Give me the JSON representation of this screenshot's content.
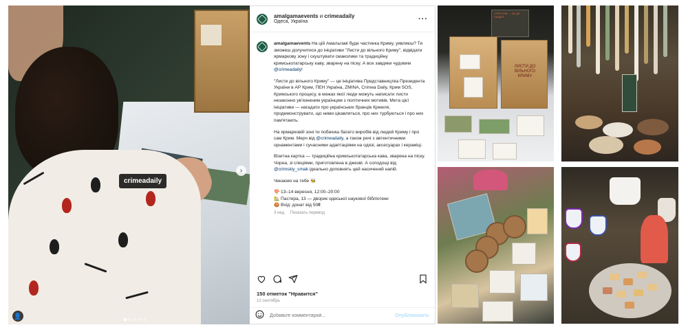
{
  "post": {
    "author": "amalgamaevents",
    "and": " и ",
    "coauthor": "crimeadaily",
    "location": "Одеса, Україна",
    "photo_tag": "crimeadaily",
    "caption": {
      "p1_user": "amalgamaevents",
      "p1_text": " На цій Амальгамі буде частинка Криму, уявляєш? Ти зможеш долучитися до ініціативи \"Листи до вільного Криму\", відвідати ярмаркову зону і скуштувати смаколики та традиційну кримськотатарську каву, зварену на піску. А все завдяки чудовим ",
      "p1_mention": "@crimeadaily",
      "p1_end": "!",
      "p2": "\"Листи до вільного Криму\" — це ініціатива Представництва Президента України в АР Крим, ПЕН Україна, ZMINA, Crimea Daily, Крим SOS, Кримського процесу, в межах якої люди можуть написати листи незаконно ув'язненим українцям з політичних мотивів. Мета цієї ініціативи — нагадати про українських бранців Кремля, продемонструвати, що ними цікавляться, про них турбуються і про них пам'ятають.",
      "p3_text": "На ярмарковій зоні ти побачиш багато виробів від людей Криму і про сам Крим. Мерч від ",
      "p3_mention": "@crimeadaily",
      "p3_end": ", а також речі з автентичними орнаментами і сучасними адаптаціями на одязі, аксесуарах і кераміці.",
      "p4_text": "Візитна картка — традиційна кримськотатарська кава, зварена на піску. Чорна, зі спеціями, приготовлена в джезві. А солодощі від ",
      "p4_mention": "@crimskiy_smak",
      "p4_end": " ідеально доповнять цей насичений напій.",
      "p5": "Чекаємо на тебе 🐝",
      "info1": "🍄 13–14 вересня, 12:00–20:00",
      "info2": "🏡 Пастера, 13 — дворик одеської наукової бібліотеки",
      "info3": "🍪 Вхід: донат від 50₴"
    },
    "caption_age": "3 нед.",
    "show_translation": "Показать перевод",
    "likes": "150 отметок \"Нравится\"",
    "date": "12 сентябрь",
    "comment_placeholder": "Добавьте комментарий...",
    "publish_label": "Опубликовать"
  },
  "grid": {
    "box_text": "ЛИСТИ ДО ВІЛЬНОГО КРИМУ",
    "poster_text": "СПРОТИВ — ЦЕ ДІЇ ЛЮДЕЙ"
  },
  "icons": {
    "like": "heart-icon",
    "comment": "comment-icon",
    "share": "share-icon",
    "save": "bookmark-icon",
    "emoji": "emoji-icon",
    "more": "more-icon",
    "next": "chevron-right-icon",
    "user_tag": "user-tag-icon"
  },
  "colors": {
    "accent_link": "#00376b",
    "publish_disabled": "#b2dffc",
    "avatar": "#1f5c46"
  }
}
